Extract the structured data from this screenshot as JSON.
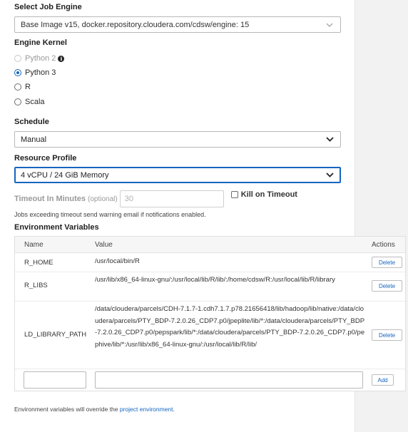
{
  "job_engine": {
    "label": "Select Job Engine",
    "selected": "Base Image v15, docker.repository.cloudera.com/cdsw/engine: 15"
  },
  "engine_kernel": {
    "label": "Engine Kernel",
    "options": [
      {
        "label": "Python 2",
        "state": "disabled",
        "has_info_icon": true
      },
      {
        "label": "Python 3",
        "state": "checked"
      },
      {
        "label": "R",
        "state": "unchecked"
      },
      {
        "label": "Scala",
        "state": "unchecked"
      }
    ]
  },
  "schedule": {
    "label": "Schedule",
    "selected": "Manual"
  },
  "resource_profile": {
    "label": "Resource Profile",
    "selected": "4 vCPU / 24 GiB Memory"
  },
  "timeout": {
    "label": "Timeout In Minutes",
    "optional": "(optional)",
    "placeholder": "30",
    "kill_label": "Kill on Timeout",
    "hint": "Jobs exceeding timeout send warning email if notifications enabled."
  },
  "env_vars": {
    "label": "Environment Variables",
    "columns": {
      "name": "Name",
      "value": "Value",
      "actions": "Actions"
    },
    "rows": [
      {
        "name": "R_HOME",
        "value": "/usr/local/bin/R",
        "action": "Delete"
      },
      {
        "name": "R_LIBS",
        "value": "/usr/lib/x86_64-linux-gnu/:/usr/local/lib/R/lib/:/home/cdsw/R:/usr/local/lib/R/library",
        "action": "Delete"
      },
      {
        "name": "LD_LIBRARY_PATH",
        "value": "/data/cloudera/parcels/CDH-7.1.7-1.cdh7.1.7.p78.21656418/lib/hadoop/lib/native:/data/cloudera/parcels/PTY_BDP-7.2.0.26_CDP7.p0/jpeplite/lib/*:/data/cloudera/parcels/PTY_BDP-7.2.0.26_CDP7.p0/pepspark/lib/*:/data/cloudera/parcels/PTY_BDP-7.2.0.26_CDP7.p0/pephive/lib/*:/usr/lib/x86_64-linux-gnu/:/usr/local/lib/R/lib/",
        "action": "Delete"
      }
    ],
    "add_label": "Add"
  },
  "footer": {
    "text": "Environment variables will override the ",
    "link": "project environment",
    "end": "."
  },
  "colors": {
    "accent": "#1565c0",
    "sidebar": "#f2f2f2"
  },
  "icons": {
    "select_caret": "chevron-down-icon",
    "info": "info-icon"
  }
}
